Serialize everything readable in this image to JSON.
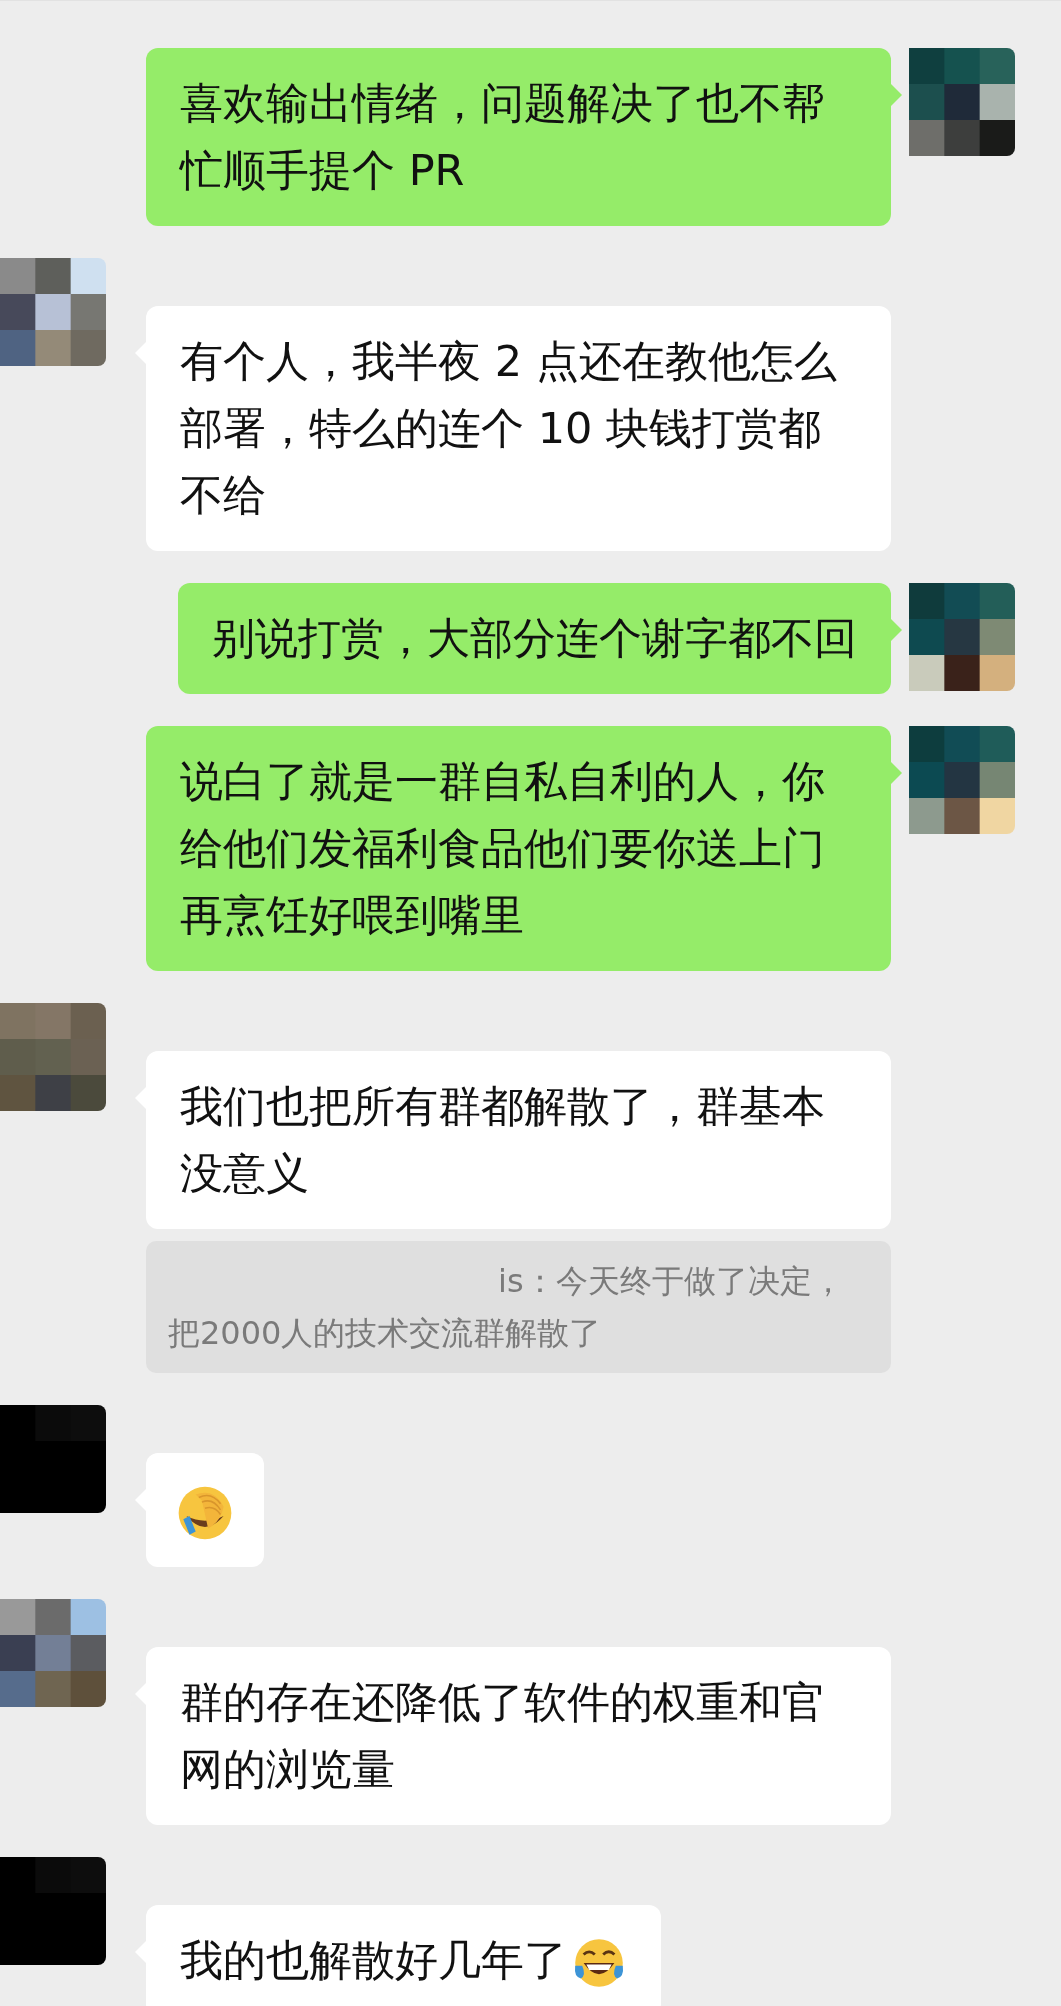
{
  "messages": [
    {
      "kind": "sent",
      "parts": [
        {
          "kind": "text",
          "text": "喜欢输出情绪，问题解决了也不帮忙顺手提个 PR"
        }
      ]
    },
    {
      "kind": "received",
      "parts": [
        {
          "kind": "text",
          "text": "有个人，我半夜 2 点还在教他怎么部署，特么的连个 10 块钱打赏都不给"
        }
      ]
    },
    {
      "kind": "sent",
      "parts": [
        {
          "kind": "text",
          "text": "别说打赏，大部分连个谢字都不回"
        }
      ]
    },
    {
      "kind": "sent",
      "parts": [
        {
          "kind": "text",
          "text": "说白了就是一群自私自利的人，你给他们发福利食品他们要你送上门再烹饪好喂到嘴里"
        }
      ]
    },
    {
      "kind": "received",
      "parts": [
        {
          "kind": "text",
          "text": "我们也把所有群都解散了，群基本没意义"
        }
      ],
      "quote": "is：今天终于做了决定，把2000人的技术交流群解散了"
    },
    {
      "kind": "received",
      "parts": [
        {
          "kind": "facepalm"
        }
      ]
    },
    {
      "kind": "received",
      "parts": [
        {
          "kind": "text",
          "text": "群的存在还降低了软件的权重和官网的浏览量"
        }
      ]
    },
    {
      "kind": "received",
      "parts": [
        {
          "kind": "text",
          "text": "我的也解散好几年了"
        },
        {
          "kind": "laughing"
        }
      ]
    }
  ]
}
